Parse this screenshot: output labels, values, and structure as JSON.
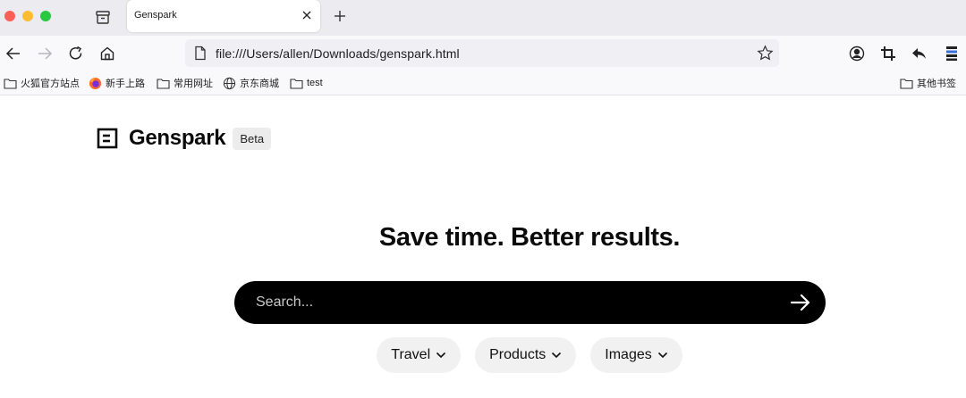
{
  "browser": {
    "tab": {
      "title": "Genspark"
    },
    "url": "file:///Users/allen/Downloads/genspark.html",
    "bookmarks": [
      {
        "label": "火狐官方站点",
        "icon": "folder-icon"
      },
      {
        "label": "新手上路",
        "icon": "firefox-icon"
      },
      {
        "label": "常用网址",
        "icon": "folder-icon"
      },
      {
        "label": "京东商城",
        "icon": "globe-icon"
      },
      {
        "label": "test",
        "icon": "folder-icon"
      }
    ],
    "other_bookmarks": "其他书签"
  },
  "page": {
    "logo_text": "Genspark",
    "beta_label": "Beta",
    "headline": "Save time. Better results.",
    "search": {
      "placeholder": "Search...",
      "value": ""
    },
    "chips": [
      {
        "label": "Travel"
      },
      {
        "label": "Products"
      },
      {
        "label": "Images"
      }
    ]
  },
  "colors": {
    "search_bg": "#000000",
    "chip_bg": "#f1f1f1",
    "traffic_red": "#fe5f57",
    "traffic_yellow": "#febc2e",
    "traffic_green": "#28c840"
  }
}
